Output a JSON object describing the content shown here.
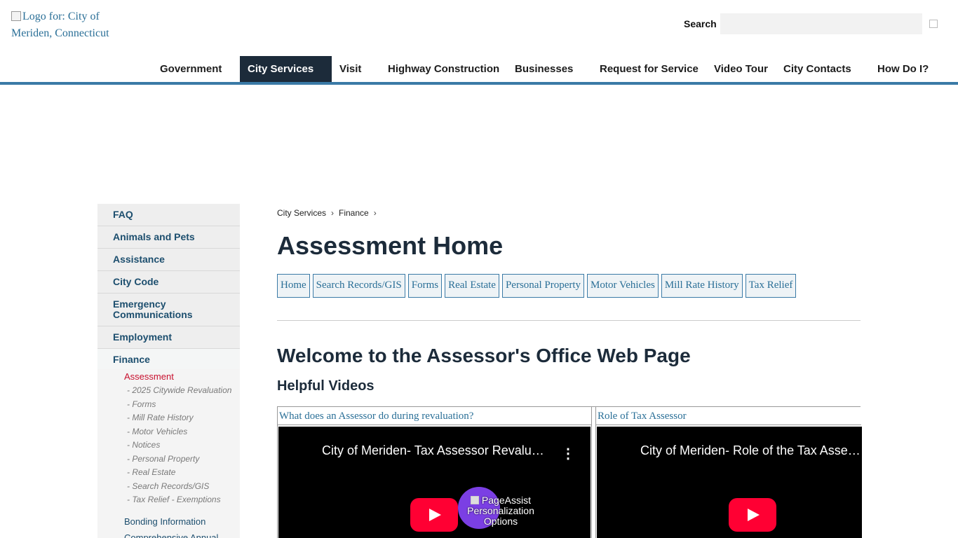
{
  "header": {
    "logo_alt": "Logo for: City of Meriden, Connecticut",
    "search_label": "Search",
    "search_value": ""
  },
  "nav": [
    {
      "label": "Government",
      "active": false
    },
    {
      "label": "City Services",
      "active": true
    },
    {
      "label": "Visit",
      "active": false
    },
    {
      "label": "Highway Construction",
      "active": false
    },
    {
      "label": "Businesses",
      "active": false
    },
    {
      "label": "Request for Service",
      "active": false
    },
    {
      "label": "Video Tour",
      "active": false
    },
    {
      "label": "City Contacts",
      "active": false
    },
    {
      "label": "How Do I?",
      "active": false
    }
  ],
  "sidebar": {
    "items": [
      "FAQ",
      "Animals and Pets",
      "Assistance",
      "City Code",
      "Emergency Communications",
      "Employment"
    ],
    "finance": "Finance",
    "assessment": "Assessment",
    "assessment_children": [
      "- 2025 Citywide Revaluation",
      "- Forms",
      "- Mill Rate History",
      "- Motor Vehicles",
      "- Notices",
      "- Personal Property",
      "- Real Estate",
      "- Search Records/GIS",
      "- Tax Relief - Exemptions"
    ],
    "finance_children": [
      "Bonding Information",
      "Comprehensive Annual"
    ]
  },
  "breadcrumb": [
    "City Services",
    "Finance"
  ],
  "page_title": "Assessment Home",
  "subnav": [
    "Home",
    "Search Records/GIS",
    "Forms",
    "Real Estate",
    "Personal Property",
    "Motor Vehicles",
    "Mill Rate History",
    "Tax Relief"
  ],
  "welcome_heading": "Welcome to the Assessor's Office Web Page",
  "videos_heading": "Helpful Videos",
  "videos": [
    {
      "caption": "What does an Assessor do during revaluation?",
      "title": "City of Meriden- Tax Assessor Revalu…"
    },
    {
      "caption": "Role of Tax Assessor",
      "title": "City of Meriden- Role of the Tax Asse…"
    }
  ],
  "pageassist": {
    "label": "PageAssist Personalization Options"
  }
}
